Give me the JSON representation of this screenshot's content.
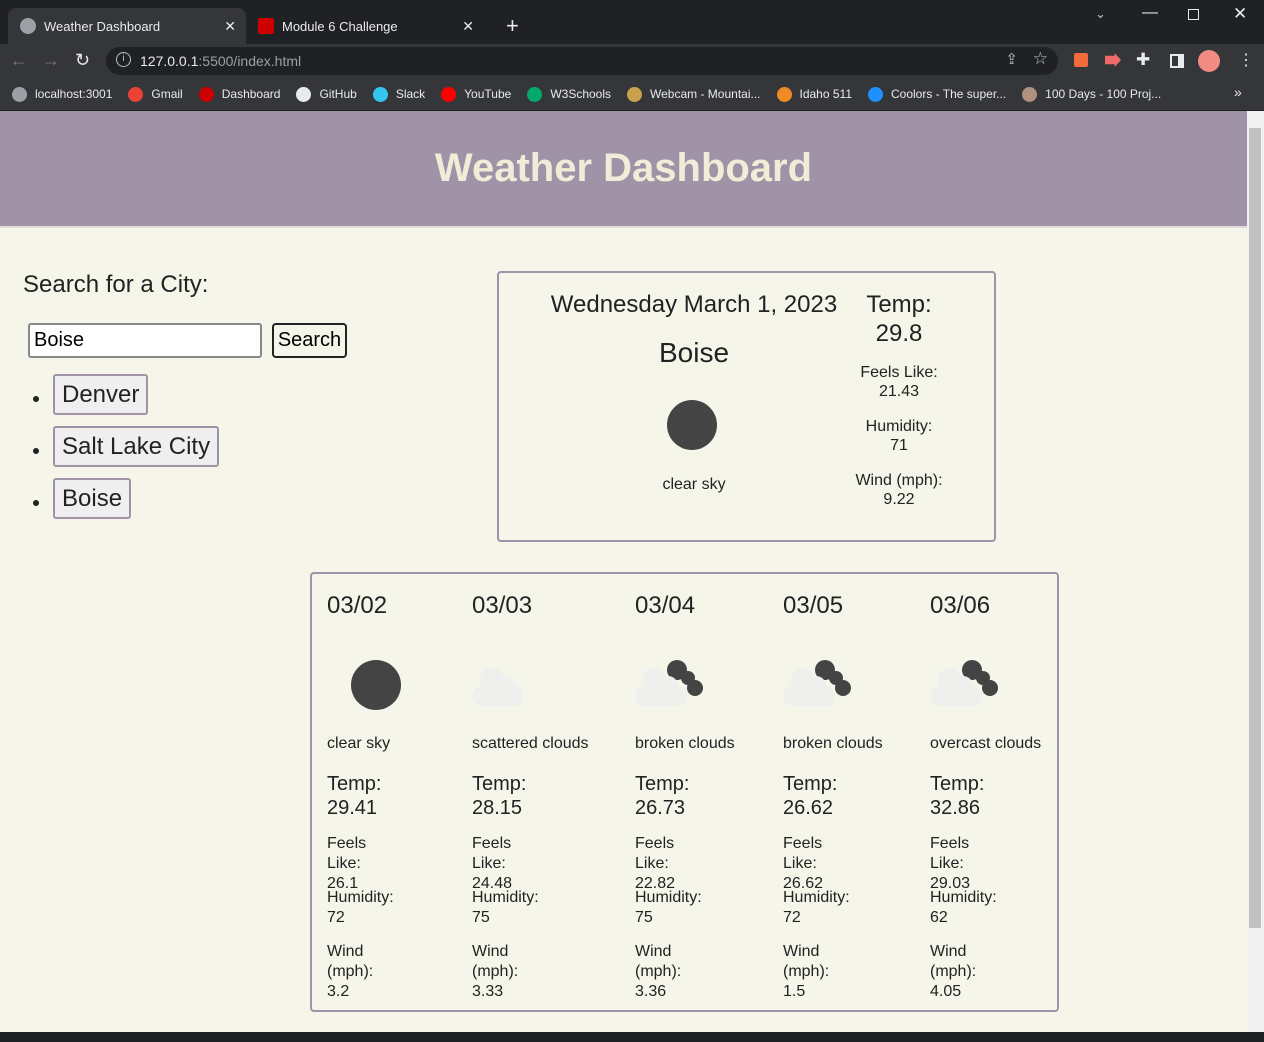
{
  "browser": {
    "tabs": [
      {
        "label": "Weather Dashboard",
        "close": "✕"
      },
      {
        "label": "Module 6 Challenge",
        "close": "✕"
      }
    ],
    "new_tab": "+",
    "url_host": "127.0.0.1",
    "url_rest": ":5500/index.html",
    "bookmarks": [
      {
        "label": "localhost:3001",
        "color": "#9aa0a6"
      },
      {
        "label": "Gmail",
        "color": "#ea4335"
      },
      {
        "label": "Dashboard",
        "color": "#cc0000"
      },
      {
        "label": "GitHub",
        "color": "#e8eaed"
      },
      {
        "label": "Slack",
        "color": "#36c5f0"
      },
      {
        "label": "YouTube",
        "color": "#ff0000"
      },
      {
        "label": "W3Schools",
        "color": "#04aa6d"
      },
      {
        "label": "Webcam - Mountai...",
        "color": "#c8a24a"
      },
      {
        "label": "Idaho 511",
        "color": "#f08a24"
      },
      {
        "label": "Coolors - The super...",
        "color": "#1e90ff"
      },
      {
        "label": "100 Days - 100 Proj...",
        "color": "#b09080"
      }
    ],
    "more": "»"
  },
  "header": {
    "title": "Weather Dashboard"
  },
  "search": {
    "heading": "Search for a City:",
    "value": "Boise",
    "button": "Search"
  },
  "history": [
    "Denver",
    "Salt Lake City",
    "Boise"
  ],
  "current": {
    "date": "Wednesday March 1, 2023",
    "city": "Boise",
    "desc": "clear sky",
    "temp_label": "Temp:",
    "temp": "29.8",
    "feels_label": "Feels Like:",
    "feels": "21.43",
    "hum_label": "Humidity:",
    "hum": "71",
    "wind_label": "Wind (mph):",
    "wind": "9.22",
    "icon": "sun"
  },
  "forecast": [
    {
      "date": "03/02",
      "icon": "sun",
      "desc": "clear sky",
      "temp": "29.41",
      "feels": "26.1",
      "hum": "72",
      "wind": "3.2"
    },
    {
      "date": "03/03",
      "icon": "cloud",
      "desc": "scattered clouds",
      "temp": "28.15",
      "feels": "24.48",
      "hum": "75",
      "wind": "3.33"
    },
    {
      "date": "03/04",
      "icon": "broken",
      "desc": "broken clouds",
      "temp": "26.73",
      "feels": "22.82",
      "hum": "75",
      "wind": "3.36"
    },
    {
      "date": "03/05",
      "icon": "broken",
      "desc": "broken clouds",
      "temp": "26.62",
      "feels": "26.62",
      "hum": "72",
      "wind": "1.5"
    },
    {
      "date": "03/06",
      "icon": "broken",
      "desc": "overcast clouds",
      "temp": "32.86",
      "feels": "29.03",
      "hum": "62",
      "wind": "4.05"
    }
  ],
  "labels": {
    "temp": "Temp:",
    "feels": "Feels Like:",
    "hum": "Humidity:",
    "wind": "Wind (mph):"
  }
}
